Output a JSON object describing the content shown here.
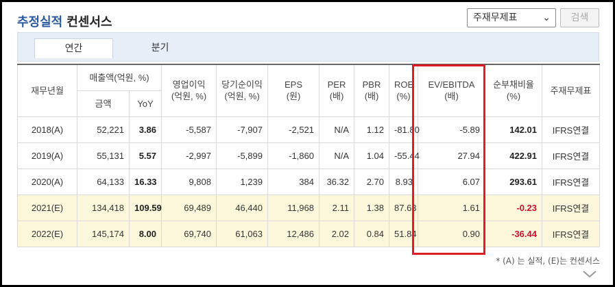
{
  "header": {
    "title_blue": "추정실적",
    "title_black": "컨센서스",
    "select_value": "주재무제표",
    "search_label": "검색"
  },
  "tabs": [
    {
      "label": "연간"
    },
    {
      "label": "분기"
    }
  ],
  "table": {
    "headers": {
      "period": "재무년월",
      "sales": "매출액(억원, %)",
      "sales_amount": "금액",
      "sales_yoy": "YoY",
      "op_profit": "영업이익",
      "op_profit_unit": "(억원, %)",
      "net_profit": "당기순이익",
      "net_profit_unit": "(억원, %)",
      "eps": "EPS",
      "eps_unit": "(원)",
      "per": "PER",
      "per_unit": "(배)",
      "pbr": "PBR",
      "pbr_unit": "(배)",
      "roe": "ROE",
      "roe_unit": "(%)",
      "ev_ebitda": "EV/EBITDA",
      "ev_ebitda_unit": "(배)",
      "net_debt_ratio": "순부채비율",
      "net_debt_ratio_unit": "(%)",
      "basis": "주재무제표"
    },
    "rows": [
      {
        "period": "2018(A)",
        "sales": "52,221",
        "yoy": "3.86",
        "op": "-5,587",
        "net": "-7,907",
        "eps": "-2,521",
        "per": "N/A",
        "pbr": "1.12",
        "roe": "-81.80",
        "ev": "-5.89",
        "debt": "142.01",
        "basis": "IFRS연결"
      },
      {
        "period": "2019(A)",
        "sales": "55,131",
        "yoy": "5.57",
        "op": "-2,997",
        "net": "-5,899",
        "eps": "-1,860",
        "per": "N/A",
        "pbr": "1.04",
        "roe": "-55.44",
        "ev": "27.94",
        "debt": "422.91",
        "basis": "IFRS연결"
      },
      {
        "period": "2020(A)",
        "sales": "64,133",
        "yoy": "16.33",
        "op": "9,808",
        "net": "1,239",
        "eps": "384",
        "per": "36.32",
        "pbr": "2.70",
        "roe": "8.93",
        "ev": "6.07",
        "debt": "293.61",
        "basis": "IFRS연결"
      },
      {
        "period": "2021(E)",
        "sales": "134,418",
        "yoy": "109.59",
        "op": "69,489",
        "net": "46,440",
        "eps": "11,968",
        "per": "2.11",
        "pbr": "1.38",
        "roe": "87.63",
        "ev": "1.61",
        "debt": "-0.23",
        "basis": "IFRS연결"
      },
      {
        "period": "2022(E)",
        "sales": "145,174",
        "yoy": "8.00",
        "op": "69,740",
        "net": "61,063",
        "eps": "12,486",
        "per": "2.02",
        "pbr": "0.84",
        "roe": "51.84",
        "ev": "0.90",
        "debt": "-36.44",
        "basis": "IFRS연결"
      }
    ]
  },
  "footnote": "* (A) 는 실적, (E)는 컨센서스",
  "colors": {
    "title_blue": "#2b5aa0",
    "estimate_row_bg": "#fdf8dc",
    "negative_text": "#c8102e",
    "highlight_box": "#e01b24"
  }
}
